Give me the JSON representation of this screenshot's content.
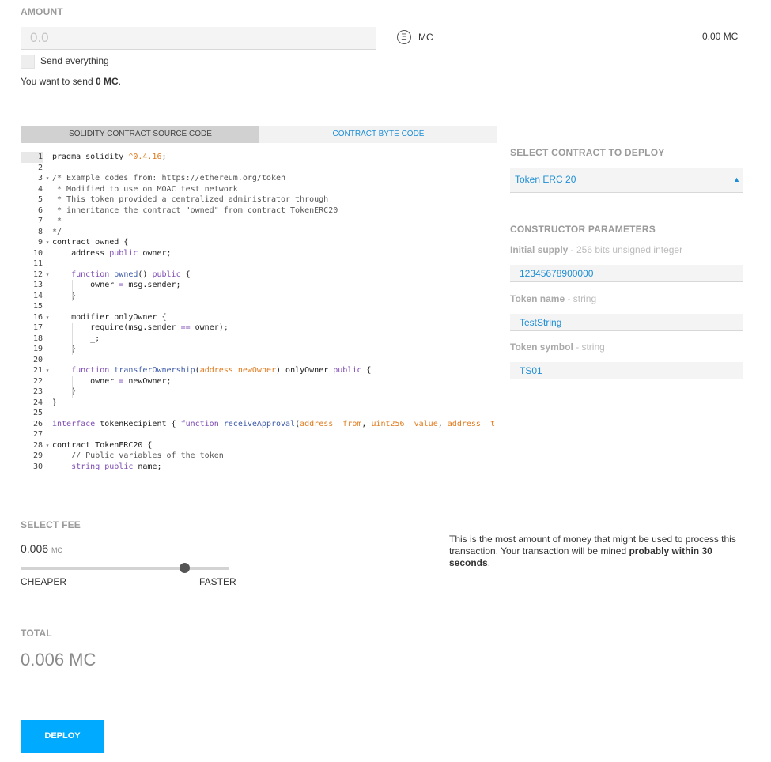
{
  "amount": {
    "label": "AMOUNT",
    "placeholder": "0.0",
    "unit": "MC",
    "unit_icon": "ether-icon",
    "balance": "0.00 MC",
    "send_everything_label": "Send everything",
    "send_summary_prefix": "You want to send ",
    "send_summary_amount": "0 MC",
    "send_summary_suffix": "."
  },
  "tabs": [
    {
      "label": "SOLIDITY CONTRACT SOURCE CODE",
      "active": true
    },
    {
      "label": "CONTRACT BYTE CODE",
      "active": false
    }
  ],
  "editor": {
    "lines": [
      {
        "n": "1",
        "fold": "",
        "html": "pragma solidity <span class=\"c-num\">^0.4.16</span>;"
      },
      {
        "n": "2",
        "fold": "",
        "html": ""
      },
      {
        "n": "3",
        "fold": "▾",
        "html": "<span class=\"c-cmt\">/* Example codes from: https://ethereum.org/token</span>"
      },
      {
        "n": "4",
        "fold": "",
        "html": "<span class=\"c-cmt\"> * Modified to use on MOAC test network</span>"
      },
      {
        "n": "5",
        "fold": "",
        "html": "<span class=\"c-cmt\"> * This token provided a centralized administrator through</span>"
      },
      {
        "n": "6",
        "fold": "",
        "html": "<span class=\"c-cmt\"> * inheritance the contract \"owned\" from contract TokenERC20</span>"
      },
      {
        "n": "7",
        "fold": "",
        "html": "<span class=\"c-cmt\"> *</span>"
      },
      {
        "n": "8",
        "fold": "",
        "html": "<span class=\"c-cmt\">*/</span>"
      },
      {
        "n": "9",
        "fold": "▾",
        "html": "contract owned {"
      },
      {
        "n": "10",
        "fold": "",
        "html": "    address <span class=\"c-kw\">public</span> owner;"
      },
      {
        "n": "11",
        "fold": "",
        "html": ""
      },
      {
        "n": "12",
        "fold": "▾",
        "html": "    <span class=\"c-kw\">function</span> <span class=\"c-fn\">owned</span>() <span class=\"c-kw\">public</span> {"
      },
      {
        "n": "13",
        "fold": "",
        "html": "        owner <span class=\"c-op\">=</span> msg.sender;"
      },
      {
        "n": "14",
        "fold": "",
        "html": "    }"
      },
      {
        "n": "15",
        "fold": "",
        "html": ""
      },
      {
        "n": "16",
        "fold": "▾",
        "html": "    modifier onlyOwner {"
      },
      {
        "n": "17",
        "fold": "",
        "html": "        require(msg.sender <span class=\"c-op\">==</span> owner);"
      },
      {
        "n": "18",
        "fold": "",
        "html": "        _;"
      },
      {
        "n": "19",
        "fold": "",
        "html": "    }"
      },
      {
        "n": "20",
        "fold": "",
        "html": ""
      },
      {
        "n": "21",
        "fold": "▾",
        "html": "    <span class=\"c-kw\">function</span> <span class=\"c-fn\">transferOwnership</span>(<span class=\"c-type\">address newOwner</span>) onlyOwner <span class=\"c-kw\">public</span> {"
      },
      {
        "n": "22",
        "fold": "",
        "html": "        owner <span class=\"c-op\">=</span> newOwner;"
      },
      {
        "n": "23",
        "fold": "",
        "html": "    }"
      },
      {
        "n": "24",
        "fold": "",
        "html": "}"
      },
      {
        "n": "25",
        "fold": "",
        "html": ""
      },
      {
        "n": "26",
        "fold": "",
        "html": "<span class=\"c-kw\">interface</span> tokenRecipient { <span class=\"c-kw\">function</span> <span class=\"c-fn\">receiveApproval</span>(<span class=\"c-type\">address _from</span>, <span class=\"c-type\">uint256 _value</span>, <span class=\"c-type\">address _t</span>"
      },
      {
        "n": "27",
        "fold": "",
        "html": ""
      },
      {
        "n": "28",
        "fold": "▾",
        "html": "contract TokenERC20 {"
      },
      {
        "n": "29",
        "fold": "",
        "html": "    <span class=\"c-cmt\">// Public variables of the token</span>"
      },
      {
        "n": "30",
        "fold": "",
        "html": "    <span class=\"c-kw\">string</span> <span class=\"c-kw\">public</span> name;"
      }
    ]
  },
  "contract_select": {
    "label": "SELECT CONTRACT TO DEPLOY",
    "selected": "Token ERC 20"
  },
  "constructor": {
    "label": "CONSTRUCTOR PARAMETERS",
    "params": [
      {
        "name": "Initial supply",
        "type": " - 256 bits unsigned integer",
        "value": "12345678900000"
      },
      {
        "name": "Token name",
        "type": " - string",
        "value": "TestString"
      },
      {
        "name": "Token symbol",
        "type": " - string",
        "value": "TS01"
      }
    ]
  },
  "fee": {
    "label": "SELECT FEE",
    "value": "0.006",
    "unit": "MC",
    "slider_fraction": 0.785,
    "cheaper_label": "CHEAPER",
    "faster_label": "FASTER",
    "note_prefix": "This is the most amount of money that might be used to process this transaction. Your transaction will be mined ",
    "note_bold": "probably within 30 seconds",
    "note_suffix": "."
  },
  "total": {
    "label": "TOTAL",
    "value": "0.006 MC"
  },
  "deploy_button": "DEPLOY"
}
